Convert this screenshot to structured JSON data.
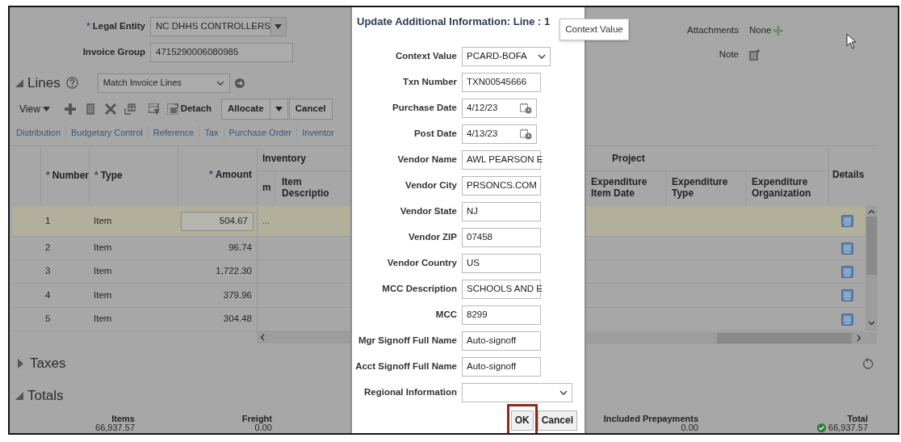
{
  "header_fields": [
    {
      "required_mark": "*",
      "label": "Legal Entity",
      "value": "NC DHHS CONTROLLERS",
      "kind": "select"
    },
    {
      "label": "Invoice Group",
      "value": "4715290006080985",
      "kind": "text"
    }
  ],
  "side_info": [
    {
      "label": "Attachments",
      "value": "None",
      "kind": "attachments"
    },
    {
      "label": "Note",
      "kind": "note"
    }
  ],
  "lines": {
    "title": "Lines",
    "expanded": true,
    "action_select": "Match Invoice Lines",
    "toolbar": {
      "view": "View",
      "detach": "Detach",
      "allocate": "Allocate",
      "cancel": "Cancel"
    },
    "links": [
      "Distribution",
      "Budgetary Control",
      "Reference",
      "Tax",
      "Purchase Order",
      "Inventor"
    ],
    "table": {
      "columns": [
        {
          "required_mark": "*",
          "label": "Number"
        },
        {
          "required_mark": "*",
          "label": "Type"
        },
        {
          "required_mark": "*",
          "label": "Amount"
        }
      ],
      "groups": [
        {
          "label": "Inventory",
          "columns": [
            "m",
            "Item Descriptio"
          ]
        },
        {
          "label": "Project",
          "columns": [
            "Expenditure Item Date",
            "Expenditure Type",
            "Expenditure Organization"
          ]
        }
      ],
      "details_column": "Details",
      "rows": [
        {
          "number": "1",
          "type": "Item",
          "amount": "504.67",
          "selected": true,
          "lookup": "..."
        },
        {
          "number": "2",
          "type": "Item",
          "amount": "96.74",
          "selected": false
        },
        {
          "number": "3",
          "type": "Item",
          "amount": "1,722.30",
          "selected": false
        },
        {
          "number": "4",
          "type": "Item",
          "amount": "379.96",
          "selected": false
        },
        {
          "number": "5",
          "type": "Item",
          "amount": "304.48",
          "selected": false
        }
      ]
    }
  },
  "sections": [
    {
      "title": "Taxes",
      "expanded": false
    },
    {
      "title": "Totals",
      "expanded": true
    }
  ],
  "totals": [
    {
      "label": "Items",
      "value": "66,937.57"
    },
    {
      "label": "Freight",
      "value": "0.00"
    },
    {
      "label": "Included Prepayments",
      "value": "0.00"
    },
    {
      "label": "Total",
      "value": "66,937.57",
      "verified": true
    }
  ],
  "dialog": {
    "title": "Update Additional Information: Line : 1",
    "fields": [
      {
        "label": "Context Value",
        "value": "PCARD-BOFA",
        "kind": "select"
      },
      {
        "label": "Txn Number",
        "value": "TXN00545666",
        "kind": "text"
      },
      {
        "label": "Purchase Date",
        "value": "4/12/23",
        "kind": "date"
      },
      {
        "label": "Post Date",
        "value": "4/13/23",
        "kind": "date"
      },
      {
        "label": "Vendor Name",
        "value": "AWL PEARSON E",
        "kind": "text"
      },
      {
        "label": "Vendor City",
        "value": "PRSONCS.COM",
        "kind": "text"
      },
      {
        "label": "Vendor State",
        "value": "NJ",
        "kind": "text"
      },
      {
        "label": "Vendor ZIP",
        "value": "07458",
        "kind": "text"
      },
      {
        "label": "Vendor Country",
        "value": "US",
        "kind": "text"
      },
      {
        "label": "MCC Description",
        "value": "SCHOOLS AND E",
        "kind": "text"
      },
      {
        "label": "MCC",
        "value": "8299",
        "kind": "text"
      },
      {
        "label": "Mgr Signoff Full Name",
        "value": "Auto-signoff",
        "kind": "text"
      },
      {
        "label": "Acct Signoff Full Name",
        "value": "Auto-signoff",
        "kind": "text"
      },
      {
        "label": "Regional Information",
        "kind": "wide_select"
      }
    ],
    "buttons": [
      {
        "label": "OK",
        "highlighted": true
      },
      {
        "label": "Cancel",
        "highlighted": false
      }
    ]
  },
  "tooltip": "Context Value"
}
